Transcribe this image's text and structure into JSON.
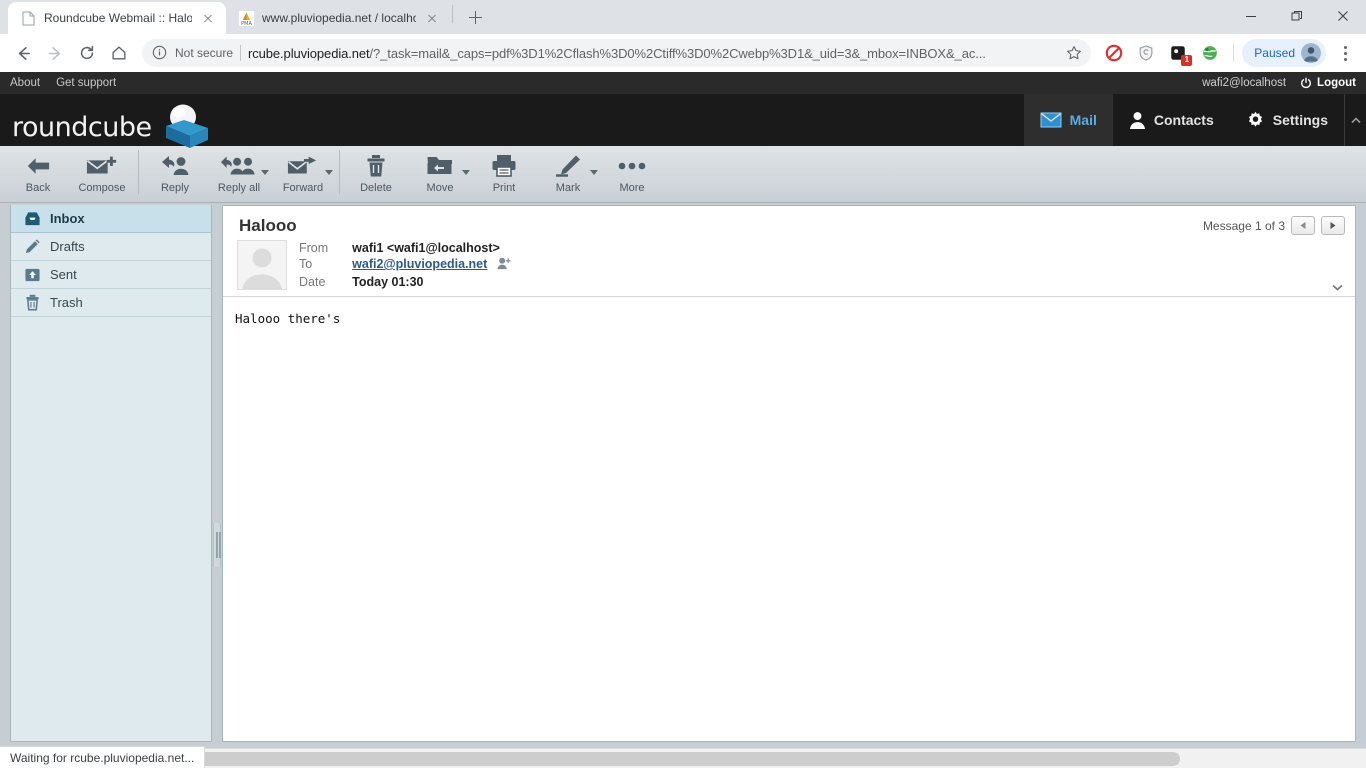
{
  "browser": {
    "tabs": [
      {
        "title": "Roundcube Webmail :: Halooo",
        "favicon": "document-icon",
        "active": true
      },
      {
        "title": "www.pluviopedia.net / localhost",
        "favicon": "phpmyadmin-icon",
        "active": false
      }
    ],
    "new_tab_label": "+",
    "window_controls": [
      "minimize",
      "restore",
      "close"
    ],
    "nav": {
      "back": "back-arrow",
      "forward": "forward-arrow",
      "reload": "reload-icon",
      "home": "home-icon"
    },
    "omnibox": {
      "security_label": "Not secure",
      "url_host": "rcube.pluviopedia.net",
      "url_path": "/?_task=mail&_caps=pdf%3D1%2Cflash%3D0%2Ctiff%3D0%2Cwebp%3D1&_uid=3&_mbox=INBOX&_ac...",
      "bookmark": "star-icon"
    },
    "extensions": [
      {
        "name": "adblock-icon",
        "badge": ""
      },
      {
        "name": "shield-icon",
        "badge": ""
      },
      {
        "name": "extension-icon",
        "badge": "1"
      },
      {
        "name": "globe-icon",
        "badge": ""
      }
    ],
    "profile": {
      "label": "Paused",
      "avatar": "user-avatar"
    },
    "menu": "three-dot-menu",
    "status_text": "Waiting for rcube.pluviopedia.net..."
  },
  "roundcube": {
    "topbar": {
      "links": [
        "About",
        "Get support"
      ],
      "user": "wafi2@localhost",
      "logout": "Logout"
    },
    "logo_text": "roundcube",
    "tasks": [
      {
        "label": "Mail",
        "icon": "envelope-icon",
        "active": true
      },
      {
        "label": "Contacts",
        "icon": "person-icon",
        "active": false
      },
      {
        "label": "Settings",
        "icon": "gear-icon",
        "active": false
      }
    ],
    "toolbar": [
      {
        "label": "Back",
        "icon": "back-arrow-icon",
        "dropdown": false
      },
      {
        "label": "Compose",
        "icon": "compose-icon",
        "dropdown": false
      },
      {
        "label": "Reply",
        "icon": "reply-icon",
        "dropdown": false
      },
      {
        "label": "Reply all",
        "icon": "reply-all-icon",
        "dropdown": true
      },
      {
        "label": "Forward",
        "icon": "forward-icon",
        "dropdown": true
      },
      {
        "label": "Delete",
        "icon": "trash-icon",
        "dropdown": false
      },
      {
        "label": "Move",
        "icon": "folder-move-icon",
        "dropdown": true
      },
      {
        "label": "Print",
        "icon": "printer-icon",
        "dropdown": false
      },
      {
        "label": "Mark",
        "icon": "pencil-mark-icon",
        "dropdown": true
      },
      {
        "label": "More",
        "icon": "ellipsis-icon",
        "dropdown": false
      }
    ],
    "folders": [
      {
        "label": "Inbox",
        "icon": "inbox-icon",
        "selected": true
      },
      {
        "label": "Drafts",
        "icon": "pencil-icon",
        "selected": false
      },
      {
        "label": "Sent",
        "icon": "sent-icon",
        "selected": false
      },
      {
        "label": "Trash",
        "icon": "trash-icon",
        "selected": false
      }
    ],
    "message": {
      "subject": "Halooo",
      "counter": "Message 1 of 3",
      "labels": {
        "from": "From",
        "to": "To",
        "date": "Date"
      },
      "from": "wafi1 <wafi1@localhost>",
      "to": "wafi2@pluviopedia.net",
      "date": "Today 01:30",
      "body": "Halooo there's"
    }
  }
}
